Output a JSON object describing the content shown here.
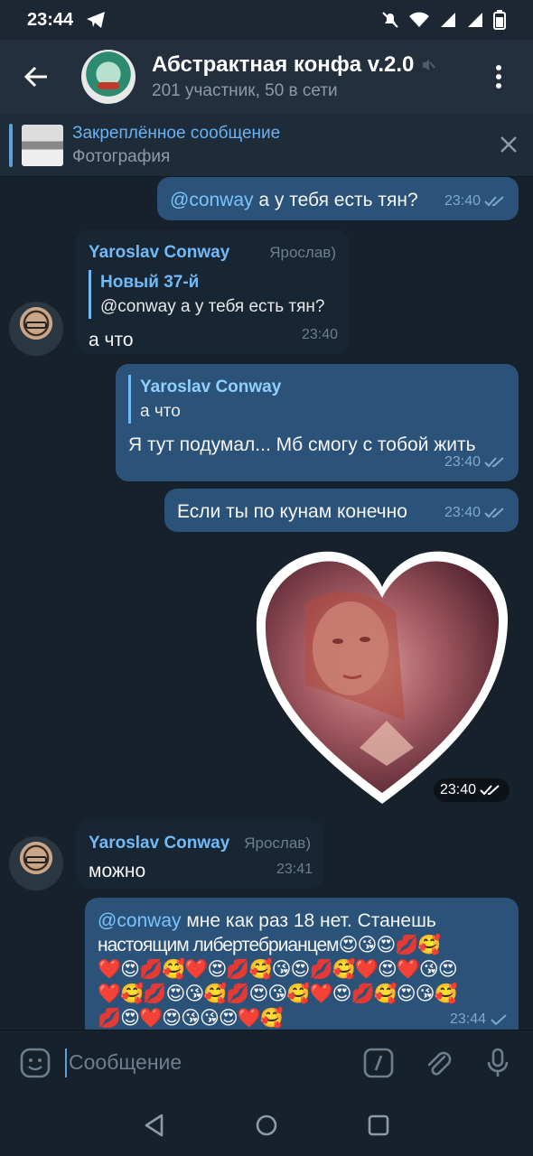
{
  "status": {
    "time": "23:44"
  },
  "header": {
    "title": "Абстрактная конфа v.2.0",
    "subtitle": "201 участник, 50 в сети"
  },
  "pinned": {
    "title": "Закреплённое сообщение",
    "subtitle": "Фотография"
  },
  "messages": {
    "m1": {
      "mention": "@conway",
      "text": " а у тебя есть тян?",
      "time": "23:40"
    },
    "m2": {
      "sender": "Yaroslav Conway",
      "tag": "Ярослав)",
      "reply_name": "Новый 37-й",
      "reply_text": "@conway а у тебя есть тян?",
      "text": "а что",
      "time": "23:40"
    },
    "m3": {
      "reply_name": "Yaroslav Conway",
      "reply_text": "а что",
      "text": "Я тут подумал... Мб смогу с тобой жить",
      "time": "23:40"
    },
    "m4": {
      "text": "Если ты по кунам конечно",
      "time": "23:40"
    },
    "m5": {
      "time": "23:40"
    },
    "m6": {
      "sender": "Yaroslav Conway",
      "tag": "Ярослав)",
      "text": "можно",
      "time": "23:41"
    },
    "m7": {
      "mention": "@conway",
      "text": " мне как раз 18 нет. Станешь",
      "line2": "настоящим либертебрианцем😍😘😍💋🥰",
      "line3": "❤️😍💋🥰❤️😍💋🥰😘😍💋🥰❤️😍❤️😘😍",
      "line4": "❤️🥰💋😍😘🥰💋😍😘🥰❤️😍💋🥰😍😘🥰",
      "line5": "💋😍❤️😍😘😘😍❤️🥰",
      "time": "23:44"
    }
  },
  "input": {
    "placeholder": "Сообщение"
  },
  "icons": {
    "back": "arrow-left-icon",
    "menu": "more-vertical-icon",
    "mute": "muted-icon",
    "close": "close-icon",
    "emoji": "emoji-icon",
    "command": "slash-command-icon",
    "attach": "paperclip-icon",
    "mic": "microphone-icon"
  },
  "colors": {
    "accent": "#6ab2f2",
    "outgoing": "#2b5278",
    "incoming": "#182533",
    "background": "#17212b"
  }
}
